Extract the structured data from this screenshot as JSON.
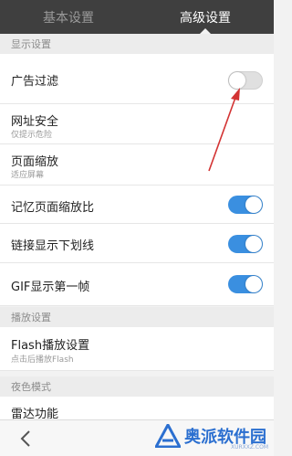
{
  "tabs": [
    {
      "label": "基本设置",
      "active": false
    },
    {
      "label": "高级设置",
      "active": true
    }
  ],
  "sections": {
    "display": "显示设置",
    "playback": "播放设置",
    "night": "夜色模式"
  },
  "rows": {
    "ad_filter": {
      "title": "广告过滤",
      "toggle": "off"
    },
    "url_security": {
      "title": "网址安全",
      "sub": "仅提示危险"
    },
    "page_zoom": {
      "title": "页面缩放",
      "sub": "适应屏幕"
    },
    "remember_zoom": {
      "title": "记忆页面缩放比",
      "toggle": "on"
    },
    "link_underline": {
      "title": "链接显示下划线",
      "toggle": "on"
    },
    "gif_first_frame": {
      "title": "GIF显示第一帧",
      "toggle": "on"
    },
    "flash_settings": {
      "title": "Flash播放设置",
      "sub": "点击后播放Flash"
    },
    "radar": {
      "title": "雷达功能"
    }
  },
  "bottom": {
    "back_icon": "chevron-left-icon",
    "watermark": "奥派软件园",
    "watermark_sub": "XURXXZ.COM"
  },
  "colors": {
    "tabbar": "#3f3f3f",
    "toggle_on": "#3a8fe0",
    "arrow": "#d33333"
  }
}
